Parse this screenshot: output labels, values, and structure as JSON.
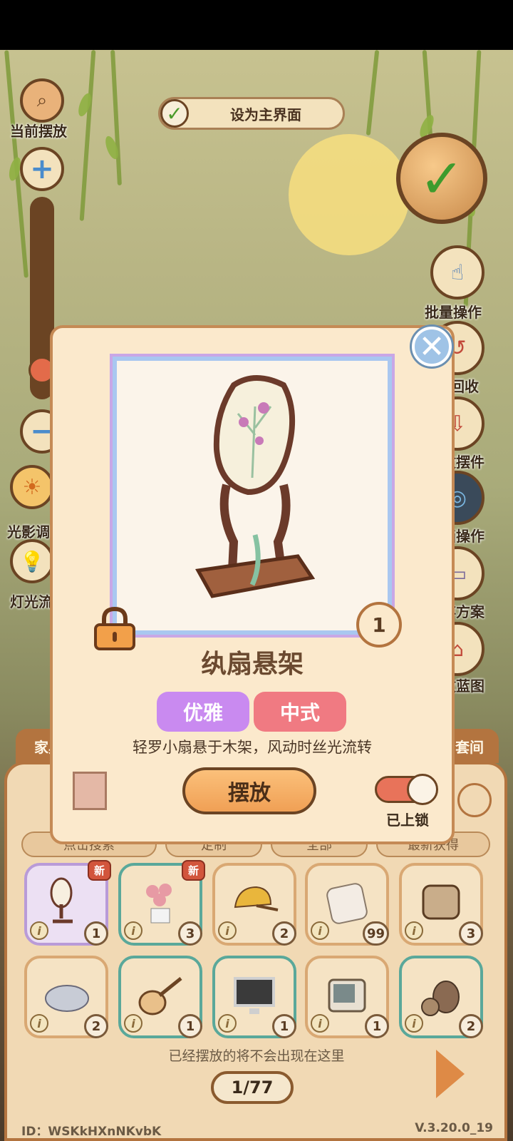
{
  "top": {
    "current_placement_label": "当前摆放",
    "set_main_label": "设为主界面"
  },
  "right_menu": {
    "batch": "批量操作",
    "recycle": "部回收",
    "store": "收摆件",
    "op": "画操作",
    "plan": "存方案",
    "blueprint": "改蓝图"
  },
  "left_menu": {
    "light_shadow": "光影调",
    "lamp": "灯光流"
  },
  "tabs": {
    "furniture": "家具",
    "suite": "套间"
  },
  "toolbar": {
    "search": "点击搜索",
    "custom": "定制",
    "all": "全部",
    "sort": "最新获得"
  },
  "modal": {
    "title": "纨扇悬架",
    "count": "1",
    "tags": [
      "优雅",
      "中式"
    ],
    "description": "轻罗小扇悬于木架，风动时丝光流转",
    "place_label": "摆放",
    "lock_label": "已上锁",
    "locked": true
  },
  "grid": [
    {
      "name": "fan-stand",
      "count": "1",
      "new": "新"
    },
    {
      "name": "rose-pot",
      "count": "3",
      "new": "新"
    },
    {
      "name": "yellow-cap",
      "count": "2"
    },
    {
      "name": "pillow",
      "count": "99"
    },
    {
      "name": "patterned-pillow",
      "count": "3"
    },
    {
      "name": "seal-plush",
      "count": "2"
    },
    {
      "name": "pipa",
      "count": "1"
    },
    {
      "name": "tv",
      "count": "1"
    },
    {
      "name": "retro-tv",
      "count": "1"
    },
    {
      "name": "clay-pots",
      "count": "2"
    }
  ],
  "hint": "已经摆放的将不会出现在这里",
  "page": "1/77",
  "footer": {
    "id": "ID：WSKkHXnNKvbK",
    "version": "V.3.20.0_19"
  },
  "colors": {
    "accent": "#b3743f",
    "tag_elegant": "#c98af0",
    "tag_chinese": "#f07a82",
    "check_green": "#3e9b2d"
  }
}
